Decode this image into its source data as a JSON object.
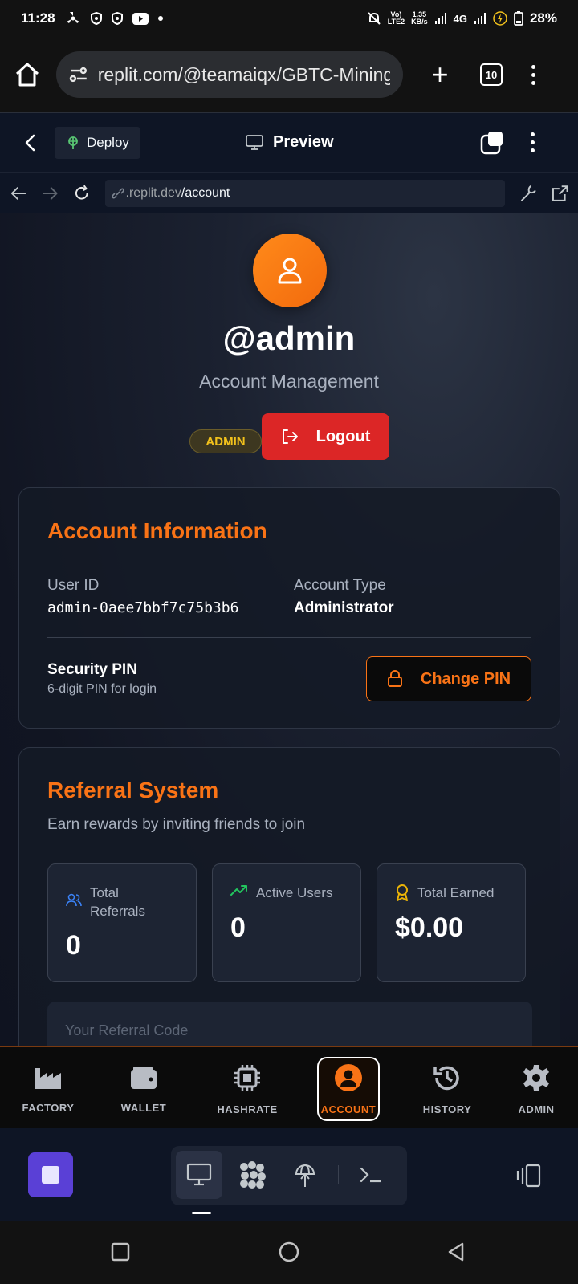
{
  "status_bar": {
    "time": "11:28",
    "volte": "Vo)\nLTE2",
    "speed_value": "1.35",
    "speed_unit": "KB/s",
    "network": "4G",
    "battery": "28%"
  },
  "browser": {
    "url": "replit.com/@teamaiqx/GBTC-Mining",
    "tab_count": "10"
  },
  "replit_header": {
    "deploy_label": "Deploy",
    "preview_label": "Preview"
  },
  "replit_url": {
    "domain": ".replit.dev",
    "path": "/account"
  },
  "profile": {
    "username": "@admin",
    "subtitle": "Account Management",
    "role_badge": "ADMIN",
    "logout_label": "Logout"
  },
  "account_info": {
    "title": "Account Information",
    "user_id_label": "User ID",
    "user_id_value": "admin-0aee7bbf7c75b3b6",
    "account_type_label": "Account Type",
    "account_type_value": "Administrator",
    "security_pin_label": "Security PIN",
    "security_pin_desc": "6-digit PIN for login",
    "change_pin_label": "Change PIN"
  },
  "referral": {
    "title": "Referral System",
    "description": "Earn rewards by inviting friends to join",
    "stats": [
      {
        "label": "Total Referrals",
        "value": "0",
        "icon": "users-icon",
        "color": "#3b82f6"
      },
      {
        "label": "Active Users",
        "value": "0",
        "icon": "trending-up-icon",
        "color": "#22c55e"
      },
      {
        "label": "Total Earned",
        "value": "$0.00",
        "icon": "award-icon",
        "color": "#eab308"
      }
    ],
    "code_label": "Your Referral Code"
  },
  "app_nav": {
    "items": [
      {
        "label": "FACTORY",
        "icon": "factory-icon"
      },
      {
        "label": "WALLET",
        "icon": "wallet-icon"
      },
      {
        "label": "HASHRATE",
        "icon": "chip-icon"
      },
      {
        "label": "ACCOUNT",
        "icon": "user-circle-icon",
        "active": true
      },
      {
        "label": "HISTORY",
        "icon": "history-icon"
      },
      {
        "label": "ADMIN",
        "icon": "gear-icon"
      }
    ]
  },
  "colors": {
    "accent": "#f97316",
    "logout": "#dc2626",
    "badge_text": "#f3c21c",
    "replit_stop": "#5a40d6"
  }
}
